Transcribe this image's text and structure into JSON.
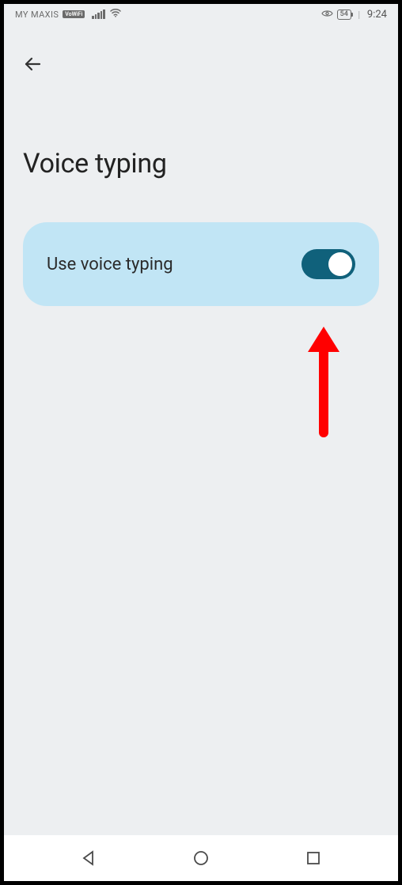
{
  "status_bar": {
    "carrier": "MY MAXIS",
    "vowifi": "VoWiFi",
    "battery": "54",
    "time": "9:24"
  },
  "page": {
    "title": "Voice typing"
  },
  "setting": {
    "label": "Use voice typing",
    "enabled": true
  }
}
